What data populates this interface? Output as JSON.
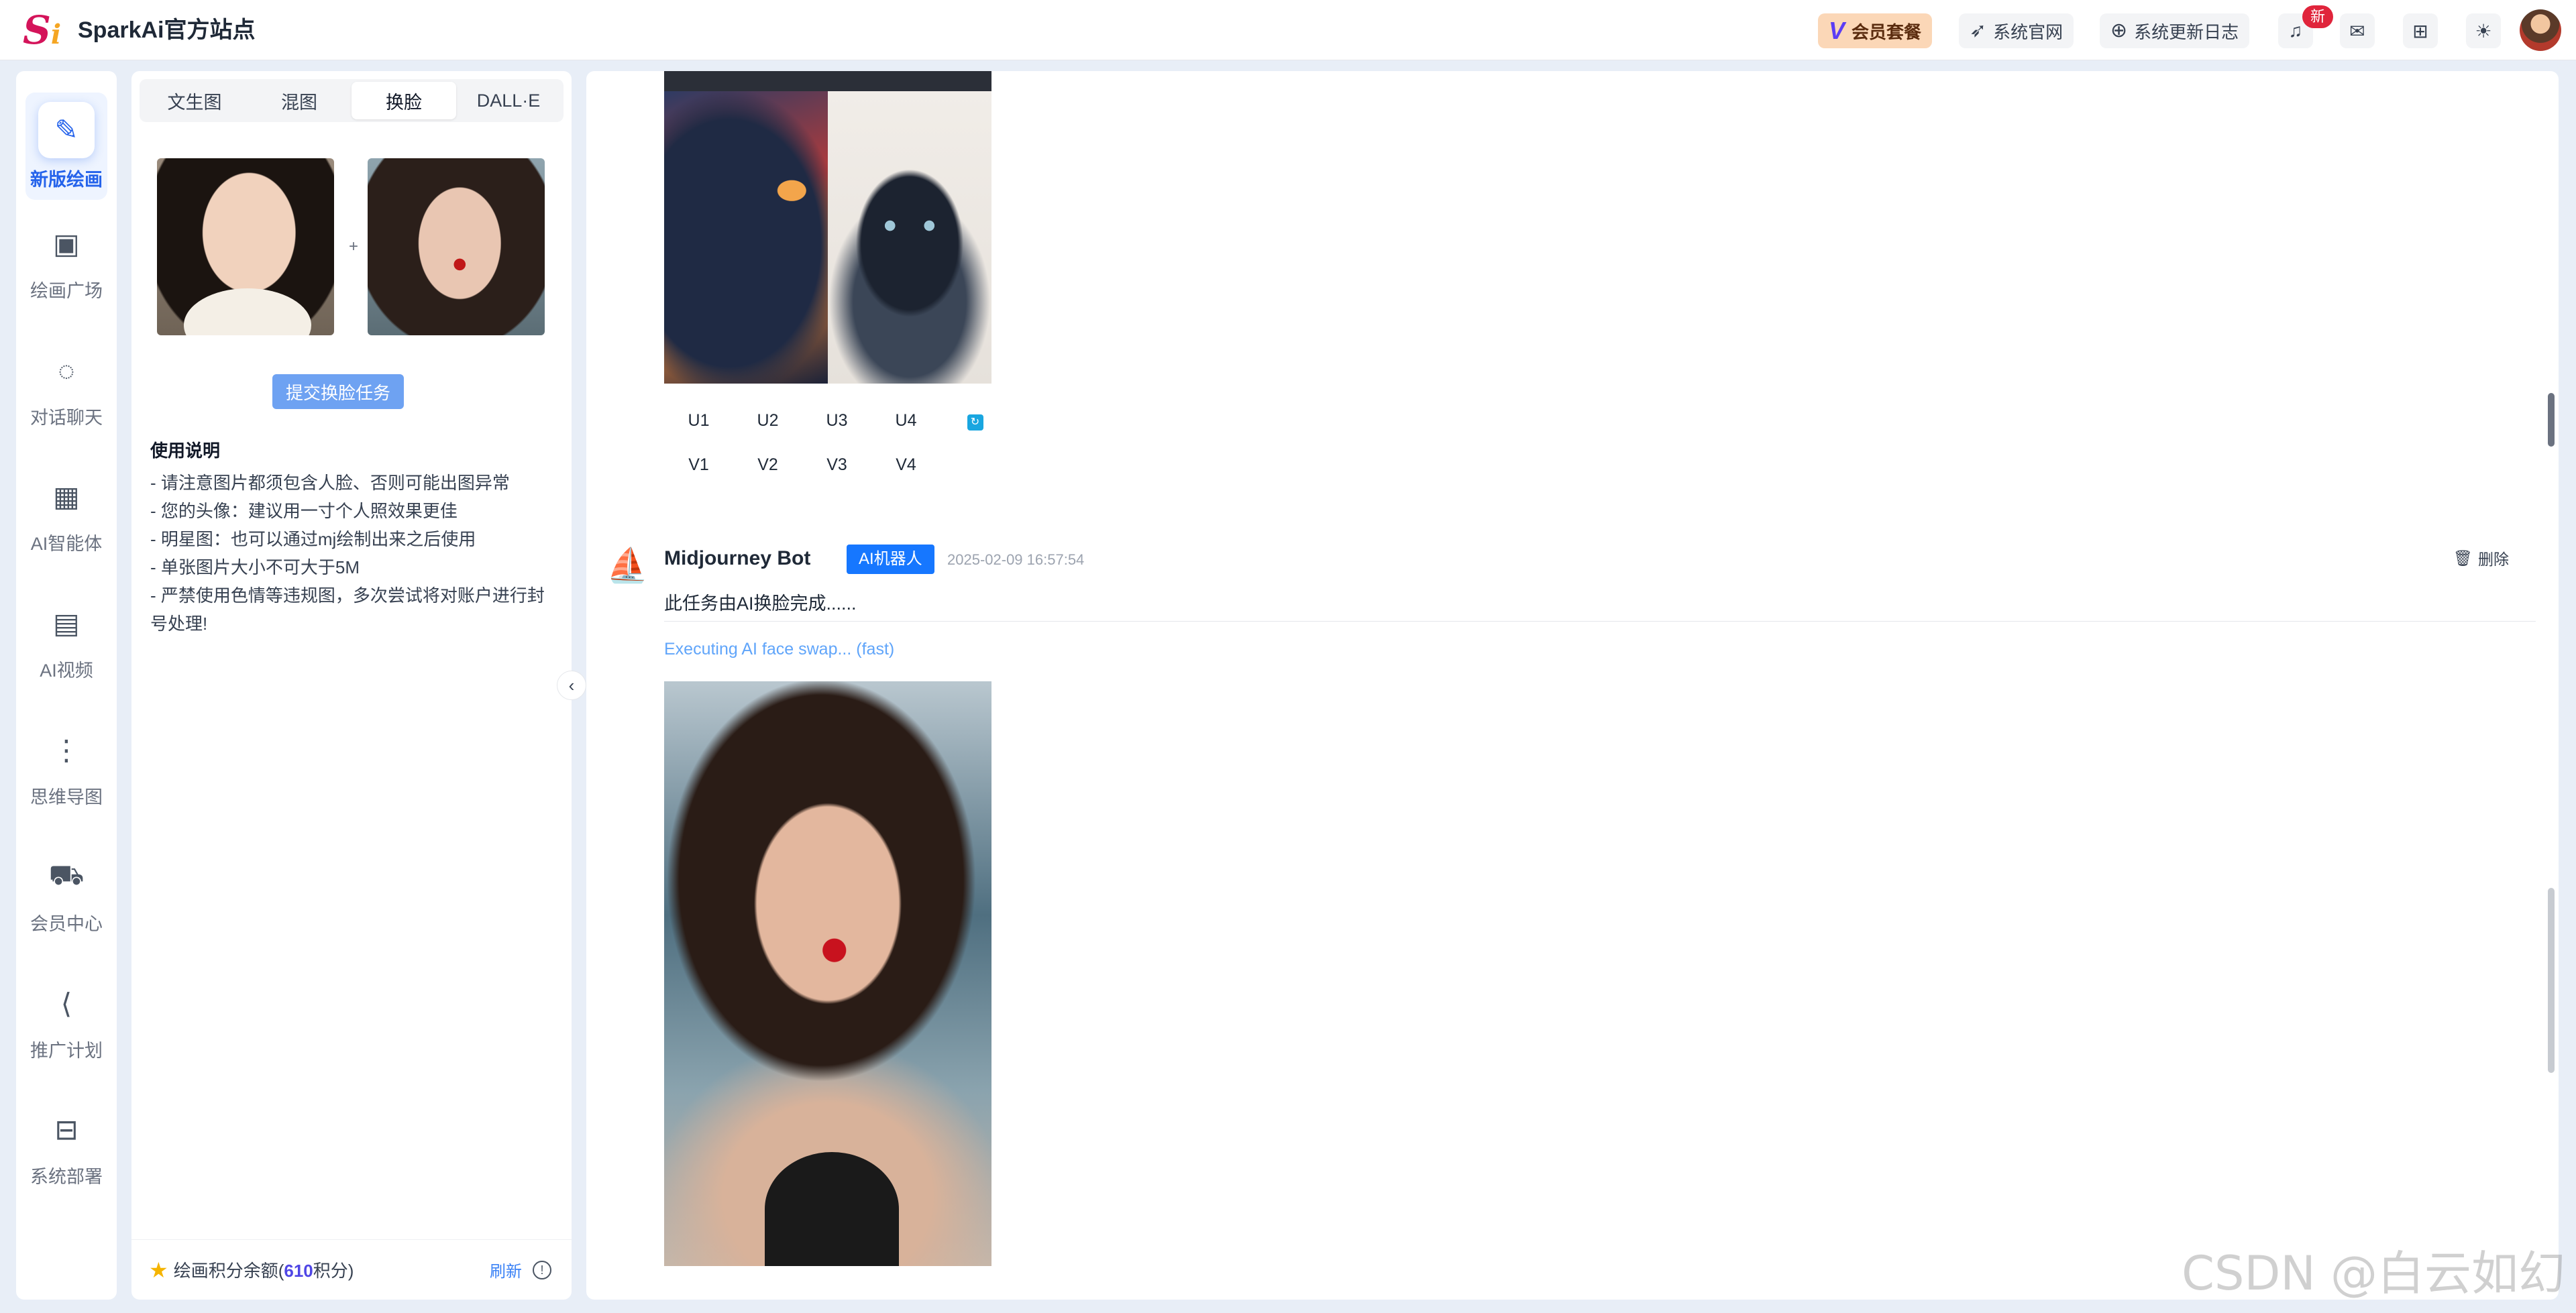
{
  "header": {
    "logo_text": "Si",
    "site_title": "SparkAi官方站点",
    "vip_label": "会员套餐",
    "official_label": "系统官网",
    "changelog_label": "系统更新日志",
    "notify_badge": "新",
    "icons": [
      "bell-icon",
      "wechat-icon",
      "gift-icon",
      "sun-icon"
    ]
  },
  "rail": {
    "items": [
      {
        "label": "新版绘画",
        "icon": "paint-icon",
        "active": true
      },
      {
        "label": "绘画广场",
        "icon": "gallery-icon"
      },
      {
        "label": "对话聊天",
        "icon": "chat-icon"
      },
      {
        "label": "AI智能体",
        "icon": "grid-icon"
      },
      {
        "label": "AI视频",
        "icon": "video-icon"
      },
      {
        "label": "思维导图",
        "icon": "mindmap-icon"
      },
      {
        "label": "会员中心",
        "icon": "cart-icon"
      },
      {
        "label": "推广计划",
        "icon": "share-icon"
      },
      {
        "label": "系统部署",
        "icon": "deploy-icon"
      }
    ]
  },
  "panel": {
    "tabs": [
      "文生图",
      "混图",
      "换脸",
      "DALL·E"
    ],
    "active_tab": "换脸",
    "plus": "+",
    "submit_label": "提交换脸任务",
    "help_title": "使用说明",
    "help_lines": [
      "- 请注意图片都须包含人脸、否则可能出图异常",
      "- 您的头像：建议用一寸个人照效果更佳",
      "- 明星图：也可以通过mj绘制出来之后使用",
      "- 单张图片大小不可大于5M",
      "- 严禁使用色情等违规图，多次尝试将对账户进行封号处理!"
    ],
    "footer": {
      "balance_prefix": "绘画积分余额(",
      "balance_value": "610",
      "balance_suffix": "积分)",
      "refresh_label": "刷新"
    }
  },
  "main": {
    "upscale_buttons": [
      "U1",
      "U2",
      "U3",
      "U4"
    ],
    "variation_buttons": [
      "V1",
      "V2",
      "V3",
      "V4"
    ],
    "message": {
      "bot_name": "Midjourney Bot",
      "bot_tag": "AI机器人",
      "time": "2025-02-09 16:57:54",
      "delete_label": "删除",
      "text": "此任务由AI换脸完成......",
      "progress": "Executing AI face swap...  (fast)"
    }
  },
  "watermark": "CSDN @白云如幻",
  "colors": {
    "accent": "#1677ff",
    "active_rail": "#2563eb",
    "submit_button": "#6ea2f2",
    "vip_pill": "#fbd7b7",
    "badge": "#e0243b"
  }
}
